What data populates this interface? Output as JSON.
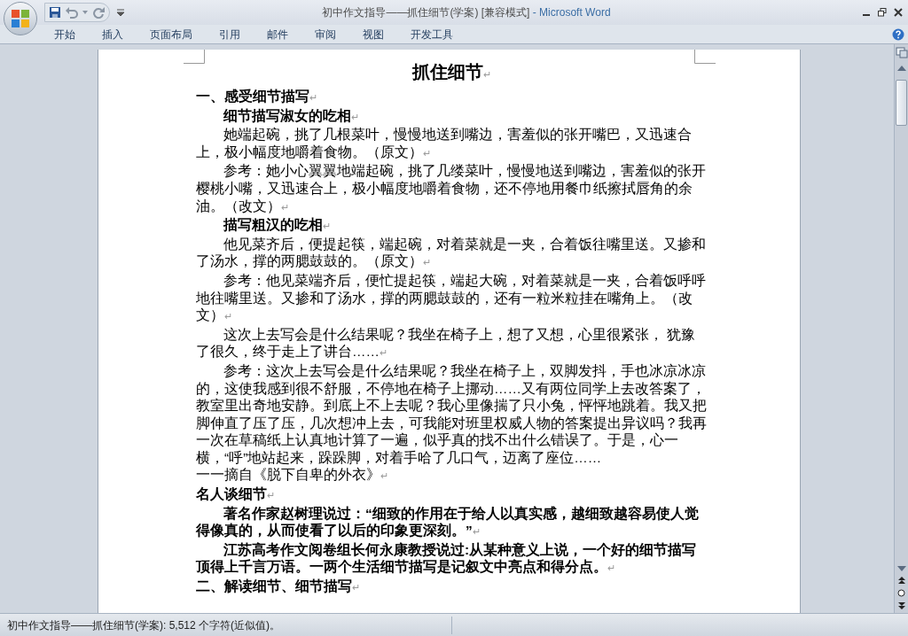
{
  "window": {
    "title": "初中作文指导——抓住细节(学案) [兼容模式]",
    "app_name": " - Microsoft Word"
  },
  "ribbon_tabs": [
    {
      "label": "开始"
    },
    {
      "label": "插入"
    },
    {
      "label": "页面布局"
    },
    {
      "label": "引用"
    },
    {
      "label": "邮件"
    },
    {
      "label": "审阅"
    },
    {
      "label": "视图"
    },
    {
      "label": "开发工具"
    }
  ],
  "document": {
    "paragraph_mark": "↵",
    "paragraphs": [
      {
        "kind": "title",
        "indented": false,
        "text": "抓住细节",
        "mark": true
      },
      {
        "kind": "heading",
        "indented": false,
        "text": "一、感受细节描写",
        "mark": true
      },
      {
        "kind": "subheading",
        "indented": true,
        "text": "细节描写淑女的吃相",
        "mark": true
      },
      {
        "kind": "body",
        "indented": true,
        "text": "她端起碗，挑了几根菜叶，慢慢地送到嘴边，害羞似的张开嘴巴，又迅速合上，极小幅度地嚼着食物。（原文）",
        "mark": true
      },
      {
        "kind": "body",
        "indented": true,
        "text": "参考：她小心翼翼地端起碗，挑了几缕菜叶，慢慢地送到嘴边，害羞似的张开樱桃小嘴，又迅速合上，极小幅度地嚼着食物，还不停地用餐巾纸擦拭唇角的余油。（改文）",
        "mark": true
      },
      {
        "kind": "subheading",
        "indented": true,
        "text": "描写粗汉的吃相",
        "mark": true
      },
      {
        "kind": "body",
        "indented": true,
        "text": "他见菜齐后，便提起筷，端起碗，对着菜就是一夹，合着饭往嘴里送。又掺和了汤水，撑的两腮鼓鼓的。（原文）",
        "mark": true
      },
      {
        "kind": "body",
        "indented": true,
        "text": "参考：他见菜端齐后，便忙提起筷，端起大碗，对着菜就是一夹，合着饭呼呼地往嘴里送。又掺和了汤水，撑的两腮鼓鼓的，还有一粒米粒挂在嘴角上。（改文）",
        "mark": true
      },
      {
        "kind": "body",
        "indented": true,
        "text": "这次上去写会是什么结果呢？我坐在椅子上，想了又想，心里很紧张， 犹豫了很久，终于走上了讲台……",
        "mark": true
      },
      {
        "kind": "body",
        "indented": true,
        "text": "参考：这次上去写会是什么结果呢？我坐在椅子上，双脚发抖，手也冰凉冰凉的，这使我感到很不舒服，不停地在椅子上挪动……又有两位同学上去改答案了，教室里出奇地安静。到底上不上去呢？我心里像揣了只小兔，怦怦地跳着。我又把脚伸直了压了压，几次想冲上去，可我能对班里权威人物的答案提出异议吗？我再一次在草稿纸上认真地计算了一遍，似乎真的找不出什么错误了。于是，心一横，“呼”地站起来，跺跺脚，对着手哈了几口气，迈离了座位……",
        "mark": false
      },
      {
        "kind": "body",
        "indented": false,
        "text": "一一摘自《脱下自卑的外衣》",
        "mark": true
      },
      {
        "kind": "heading",
        "indented": false,
        "text": "名人谈细节",
        "mark": true
      },
      {
        "kind": "emphasis",
        "indented": true,
        "text": "著名作家赵树理说过：“细致的作用在于给人以真实感，越细致越容易使人觉得像真的，从而使看了以后的印象更深刻。”",
        "mark": true
      },
      {
        "kind": "emphasis",
        "indented": true,
        "text": "江苏高考作文阅卷组长何永康教授说过:从某种意义上说，一个好的细节描写顶得上千言万语。一两个生活细节描写是记叙文中亮点和得分点。",
        "mark": true
      },
      {
        "kind": "heading",
        "indented": false,
        "text": "二、解读细节、细节描写",
        "mark": true
      }
    ]
  },
  "status_bar": {
    "text": "初中作文指导——抓住细节(学案): 5,512 个字符(近似值)。"
  }
}
